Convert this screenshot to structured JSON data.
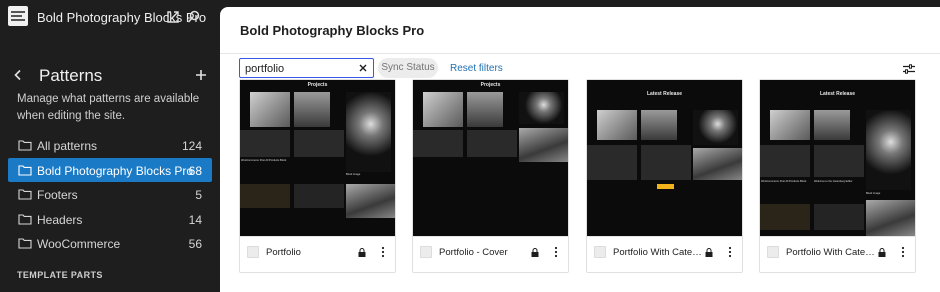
{
  "site": {
    "title": "Bold Photography Blocks Pro",
    "icon": "site-logo-icon"
  },
  "hub": {
    "view_site_icon": "external-link-icon",
    "search_icon": "search-icon"
  },
  "nav": {
    "back_icon": "chevron-left-icon",
    "title": "Patterns",
    "add_icon": "plus-icon",
    "description": "Manage what patterns are available when editing the site.",
    "items": [
      {
        "label": "All patterns",
        "count": "124",
        "icon": "folder-icon",
        "active": false
      },
      {
        "label": "Bold Photography Blocks Pro",
        "count": "68",
        "icon": "folder-icon",
        "active": true
      },
      {
        "label": "Footers",
        "count": "5",
        "icon": "folder-icon",
        "active": false
      },
      {
        "label": "Headers",
        "count": "14",
        "icon": "folder-icon",
        "active": false
      },
      {
        "label": "WooCommerce",
        "count": "56",
        "icon": "folder-icon",
        "active": false
      }
    ],
    "template_parts_label": "TEMPLATE PARTS"
  },
  "main": {
    "title": "Bold Photography Blocks Pro",
    "search": {
      "value": "portfolio",
      "clear_icon": "close-icon"
    },
    "sync_status_label": "Sync Status",
    "reset_filters_label": "Reset filters",
    "filters_icon": "sliders-icon"
  },
  "patterns": [
    {
      "title": "Portfolio",
      "locked": true,
      "heading": "Projects",
      "caption1": "WooCommerce Post All Products Block",
      "caption2": "Welcome to the Gutenberg Editor",
      "caption3": "Block Image"
    },
    {
      "title": "Portfolio - Cover",
      "locked": true,
      "heading": "Projects"
    },
    {
      "title": "Portfolio With Category",
      "locked": true,
      "heading": "Latest Release"
    },
    {
      "title": "Portfolio With Category",
      "locked": true,
      "heading": "Latest Release",
      "caption1": "WooCommerce Post All Products Block",
      "caption2": "Welcome to the Gutenberg Editor",
      "caption3": "Block Image"
    }
  ],
  "colors": {
    "sidebar_bg": "#1e1e1e",
    "active_item": "#1b7ac5",
    "focus_border": "#3858e9",
    "link": "#2271b1"
  }
}
